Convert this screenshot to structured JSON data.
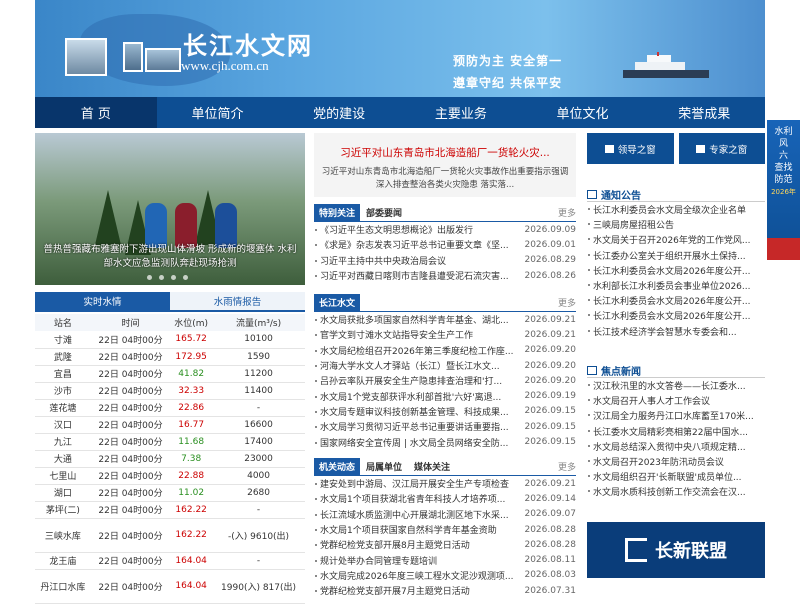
{
  "site": {
    "title": "长江水文网",
    "url": "www.cjh.com.cn",
    "slogan1": "预防为主  安全第一",
    "slogan2": "遵章守纪  共保平安"
  },
  "nav": [
    "首 页",
    "单位简介",
    "党的建设",
    "主要业务",
    "单位文化",
    "荣誉成果"
  ],
  "hero": {
    "caption": "普热普强藏布雅塞附下游出现山体滑坡 形成新的堰塞体 水利部水文应急监测队奔赴现场抢测"
  },
  "water": {
    "tabs": [
      "实时水情",
      "水雨情报告"
    ],
    "headers": [
      "站名",
      "时间",
      "水位(m)",
      "流量(m³/s)"
    ],
    "rows": [
      {
        "name": "寸滩",
        "time": "22日 04时00分",
        "level": "165.72",
        "flow": "10100",
        "green": false
      },
      {
        "name": "武隆",
        "time": "22日 04时00分",
        "level": "172.95",
        "flow": "1590",
        "green": false
      },
      {
        "name": "宜昌",
        "time": "22日 04时00分",
        "level": "41.82",
        "flow": "11200",
        "green": true
      },
      {
        "name": "沙市",
        "time": "22日 04时00分",
        "level": "32.33",
        "flow": "11400",
        "green": false
      },
      {
        "name": "莲花塘",
        "time": "22日 04时00分",
        "level": "22.86",
        "flow": "-",
        "green": false
      },
      {
        "name": "汉口",
        "time": "22日 04时00分",
        "level": "16.77",
        "flow": "16600",
        "green": false
      },
      {
        "name": "九江",
        "time": "22日 04时00分",
        "level": "11.68",
        "flow": "17400",
        "green": true
      },
      {
        "name": "大通",
        "time": "22日 04时00分",
        "level": "7.38",
        "flow": "23000",
        "green": true
      },
      {
        "name": "七里山",
        "time": "22日 04时00分",
        "level": "22.88",
        "flow": "4000",
        "green": false
      },
      {
        "name": "湖口",
        "time": "22日 04时00分",
        "level": "11.02",
        "flow": "2680",
        "green": true
      },
      {
        "name": "茅坪(二)",
        "time": "22日 04时00分",
        "level": "162.22",
        "flow": "-",
        "green": false
      },
      {
        "name": "三峡水库",
        "time": "22日 04时00分",
        "level": "162.22",
        "flow": "-(入) 9610(出)",
        "green": false
      },
      {
        "name": "龙王庙",
        "time": "22日 04时00分",
        "level": "164.04",
        "flow": "-",
        "green": false
      },
      {
        "name": "丹江口水库",
        "time": "22日 04时00分",
        "level": "164.04",
        "flow": "1990(入) 817(出)",
        "green": false
      }
    ]
  },
  "headline": {
    "title": "习近平对山东青岛市北海造船厂一货轮火灾...",
    "summary": "习近平对山东青岛市北海造船厂一货轮火灾事故作出重要指示强调 深入排查整治各类火灾隐患 落实落..."
  },
  "special": {
    "tabs": [
      "特别关注",
      "部委要闻"
    ],
    "more": "更多",
    "items": [
      {
        "t": "《习近平生态文明思想概论》出版发行",
        "d": "2026.09.09"
      },
      {
        "t": "《求是》杂志发表习近平总书记重要文章《坚...",
        "d": "2026.09.01"
      },
      {
        "t": "习近平主持中共中央政治局会议",
        "d": "2026.08.29"
      },
      {
        "t": "习近平对西藏日喀则市吉隆县遭受泥石流灾害...",
        "d": "2026.08.26"
      }
    ]
  },
  "cjsw": {
    "tab": "长江水文",
    "more": "更多",
    "items": [
      {
        "t": "水文局获批多项国家自然科学青年基金、湖北...",
        "d": "2026.09.21"
      },
      {
        "t": "官学文到寸滩水文站指导安全生产工作",
        "d": "2026.09.21"
      },
      {
        "t": "水文局纪检组召开2026年第三季度纪检工作座...",
        "d": "2026.09.20"
      },
      {
        "t": "河海大学水文人才驿站（长江）暨长江水文...",
        "d": "2026.09.20"
      },
      {
        "t": "吕孙云率队开展安全生产隐患排查治理和'打...",
        "d": "2026.09.20"
      },
      {
        "t": "水文局1个党支部获评水利部首批'六好'离退...",
        "d": "2026.09.19"
      },
      {
        "t": "水文局专题审议科技创新基金管理、科技成果...",
        "d": "2026.09.15"
      },
      {
        "t": "水文局学习贯彻习近平总书记重要讲话重要指...",
        "d": "2026.09.15"
      },
      {
        "t": "国家网络安全宣传周 | 水文局全员网络安全防...",
        "d": "2026.09.15"
      }
    ]
  },
  "jgdt": {
    "tabs": [
      "机关动态",
      "局属单位",
      "媒体关注"
    ],
    "more": "更多",
    "items": [
      {
        "t": "建安处到中游局、汉江局开展安全生产专项检查",
        "d": "2026.09.21"
      },
      {
        "t": "水文局1个项目获湖北省青年科技人才培养项...",
        "d": "2026.09.14"
      },
      {
        "t": "长江流域水质监测中心开展湖北测区地下水采...",
        "d": "2026.09.07"
      },
      {
        "t": "水文局1个项目获国家自然科学青年基金资助",
        "d": "2026.08.28"
      },
      {
        "t": "党群纪检党支部开展8月主题党日活动",
        "d": "2026.08.28"
      },
      {
        "t": "规计处举办合同管理专题培训",
        "d": "2026.08.11"
      },
      {
        "t": "水文局完成2026年度三峡工程水文泥沙观测项...",
        "d": "2026.08.03"
      },
      {
        "t": "党群纪检党支部开展7月主题党日活动",
        "d": "2026.07.31"
      }
    ]
  },
  "windows": [
    "领导之窗",
    "专家之窗"
  ],
  "notices": {
    "title": "通知公告",
    "items": [
      "长江水利委员会水文局全级次企业名单",
      "三峡局房屋招租公告",
      "水文局关于召开2026年党的工作党风...",
      "长江委办公室关于组织开展水土保持...",
      "长江水利委员会水文局2026年度公开...",
      "水利部长江水利委员会事业单位2026...",
      "长江水利委员会水文局2026年度公开...",
      "长江水利委员会水文局2026年度公开...",
      "长江技术经济学会智慧水专委会和..."
    ]
  },
  "focus": {
    "title": "焦点新闻",
    "items": [
      "汉江秋汛里的水文答卷——长江委水...",
      "水文局召开人事人才工作会议",
      "汉江局全力服务丹江口水库蓄至170米...",
      "长江委水文局精彩亮相第22届中国水...",
      "水文局总结深入贯彻中央八项规定精...",
      "水文局召开2023年防汛动员会议",
      "水文局组织召开'长新联盟'成员单位...",
      "水文局水质科技创新工作交流会在汉..."
    ]
  },
  "logo": {
    "text": "长新联盟"
  },
  "side": {
    "l1": "水利",
    "l2": "风",
    "l3": "六",
    "l4": "查找",
    "l5": "防范",
    "l6": "2026年"
  },
  "colors": {
    "nav": "#0d4e93",
    "accent": "#1a5aa5",
    "alert": "#cc0000",
    "green": "#2a8f20"
  }
}
